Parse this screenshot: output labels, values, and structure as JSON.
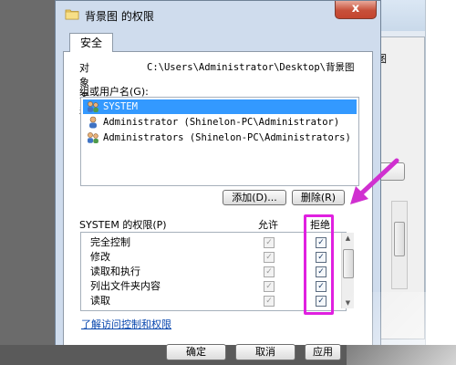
{
  "dialog": {
    "title": "背景图 的权限",
    "close_glyph": "x",
    "tab_label": "安全",
    "object_label": "对象名称:",
    "object_value": "C:\\Users\\Administrator\\Desktop\\背景图",
    "group_label": "组或用户名(G):",
    "users": [
      {
        "label": "SYSTEM",
        "selected": true,
        "icon": "users-group-icon"
      },
      {
        "label": "Administrator (Shinelon-PC\\Administrator)",
        "selected": false,
        "icon": "user-icon"
      },
      {
        "label": "Administrators (Shinelon-PC\\Administrators)",
        "selected": false,
        "icon": "users-group-icon"
      }
    ],
    "add_button": "添加(D)...",
    "remove_button": "删除(R)",
    "permissions_title": "SYSTEM 的权限(P)",
    "allow_header": "允许",
    "deny_header": "拒绝",
    "permissions": [
      {
        "name": "完全控制",
        "allow": true,
        "deny": true
      },
      {
        "name": "修改",
        "allow": true,
        "deny": true
      },
      {
        "name": "读取和执行",
        "allow": true,
        "deny": true
      },
      {
        "name": "列出文件夹内容",
        "allow": true,
        "deny": true
      },
      {
        "name": "读取",
        "allow": true,
        "deny": true
      }
    ],
    "learn_link": "了解访问控制和权限",
    "ok_button": "确定",
    "cancel_button": "取消",
    "apply_button": "应用"
  },
  "background_window": {
    "peek_text": "图"
  },
  "colors": {
    "selection": "#3399ff",
    "highlight_annotation": "#e020e0",
    "arrow_annotation": "#d030d0",
    "link": "#0645ad"
  }
}
